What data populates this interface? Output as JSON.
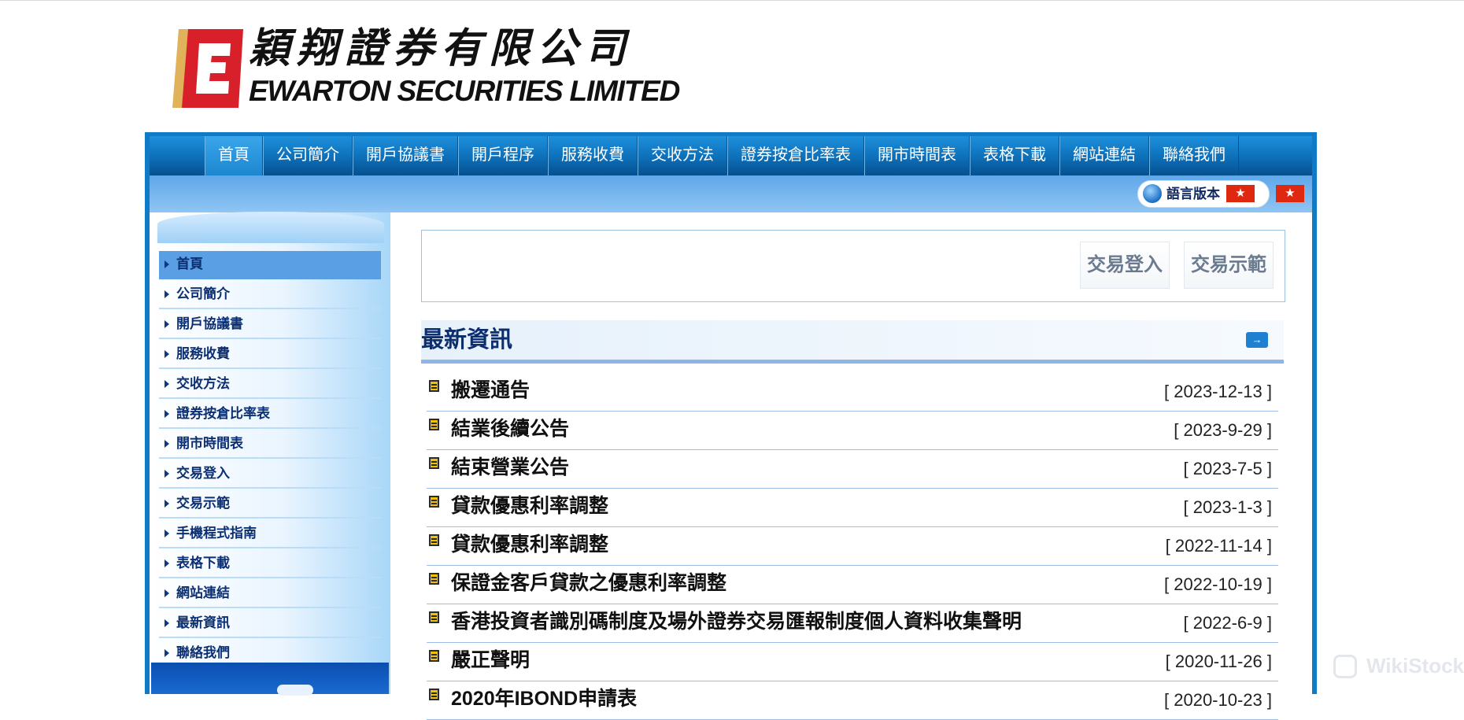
{
  "logo": {
    "mark_letter": "E",
    "name_cn": "穎翔證券有限公司",
    "name_en": "EWARTON SECURITIES LIMITED"
  },
  "nav": {
    "items": [
      "首頁",
      "公司簡介",
      "開戶協議書",
      "開戶程序",
      "服務收費",
      "交收方法",
      "證券按倉比率表",
      "開市時間表",
      "表格下載",
      "網站連結",
      "聯絡我們"
    ],
    "active": "首頁"
  },
  "lang": {
    "label": "語言版本",
    "flag_glyph": "★"
  },
  "sidebar": {
    "items": [
      "首頁",
      "公司簡介",
      "開戶協議書",
      "服務收費",
      "交收方法",
      "證券按倉比率表",
      "開市時間表",
      "交易登入",
      "交易示範",
      "手機程式指南",
      "表格下載",
      "網站連結",
      "最新資訊",
      "聯絡我們"
    ],
    "active": "首頁"
  },
  "trade": {
    "login_label": "交易登入",
    "demo_label": "交易示範"
  },
  "news": {
    "title": "最新資訊",
    "more_glyph": "→",
    "items": [
      {
        "title": "搬遷通告",
        "date": "[ 2023-12-13 ]"
      },
      {
        "title": "結業後續公告",
        "date": "[ 2023-9-29 ]"
      },
      {
        "title": "結束營業公告",
        "date": "[ 2023-7-5 ]"
      },
      {
        "title": "貸款優惠利率調整",
        "date": "[ 2023-1-3 ]"
      },
      {
        "title": "貸款優惠利率調整",
        "date": "[ 2022-11-14 ]"
      },
      {
        "title": "保證金客戶貸款之優惠利率調整",
        "date": "[ 2022-10-19 ]"
      },
      {
        "title": "香港投資者識別碼制度及場外證券交易匯報制度個人資料收集聲明",
        "date": "[ 2022-6-9 ]"
      },
      {
        "title": "嚴正聲明",
        "date": "[ 2020-11-26 ]"
      },
      {
        "title": "2020年IBOND申請表",
        "date": "[ 2020-10-23 ]"
      }
    ]
  },
  "watermark": {
    "text": "WikiStock"
  },
  "colors": {
    "brand_blue": "#0f7ac6",
    "nav_text": "#ffffff",
    "title_navy": "#0c2d6e",
    "logo_red": "#d7202a",
    "logo_gold": "#e0b25a"
  }
}
